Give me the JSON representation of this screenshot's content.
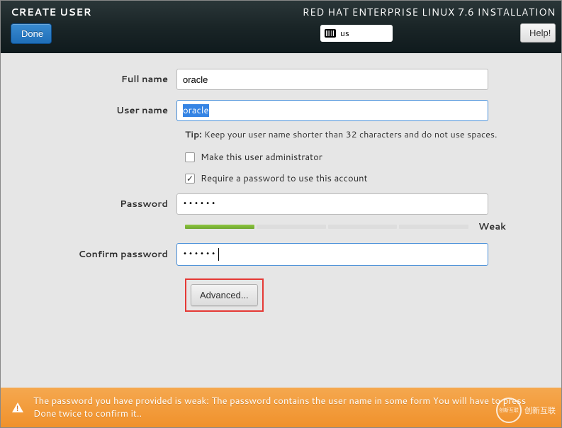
{
  "header": {
    "page_title": "CREATE USER",
    "done_label": "Done",
    "install_title": "RED HAT ENTERPRISE LINUX 7.6 INSTALLATION",
    "keyboard_layout": "us",
    "help_label": "Help!"
  },
  "form": {
    "full_name_label": "Full name",
    "full_name_value": "oracle",
    "user_name_label": "User name",
    "user_name_value": "oracle",
    "tip_prefix": "Tip:",
    "tip_text": " Keep your user name shorter than 32 characters and do not use spaces.",
    "admin_checkbox_label": "Make this user administrator",
    "admin_checked": false,
    "require_password_label": "Require a password to use this account",
    "require_password_checked": true,
    "password_label": "Password",
    "password_value": "••••••",
    "password_strength_label": "Weak",
    "password_strength_segments": 4,
    "password_strength_filled": 1,
    "confirm_password_label": "Confirm password",
    "confirm_password_value": "••••••",
    "advanced_label": "Advanced..."
  },
  "warning": {
    "text": "The password you have provided is weak: The password contains the user name in some form You will have to press Done twice to confirm it.."
  },
  "watermark": {
    "text": "创新互联"
  }
}
